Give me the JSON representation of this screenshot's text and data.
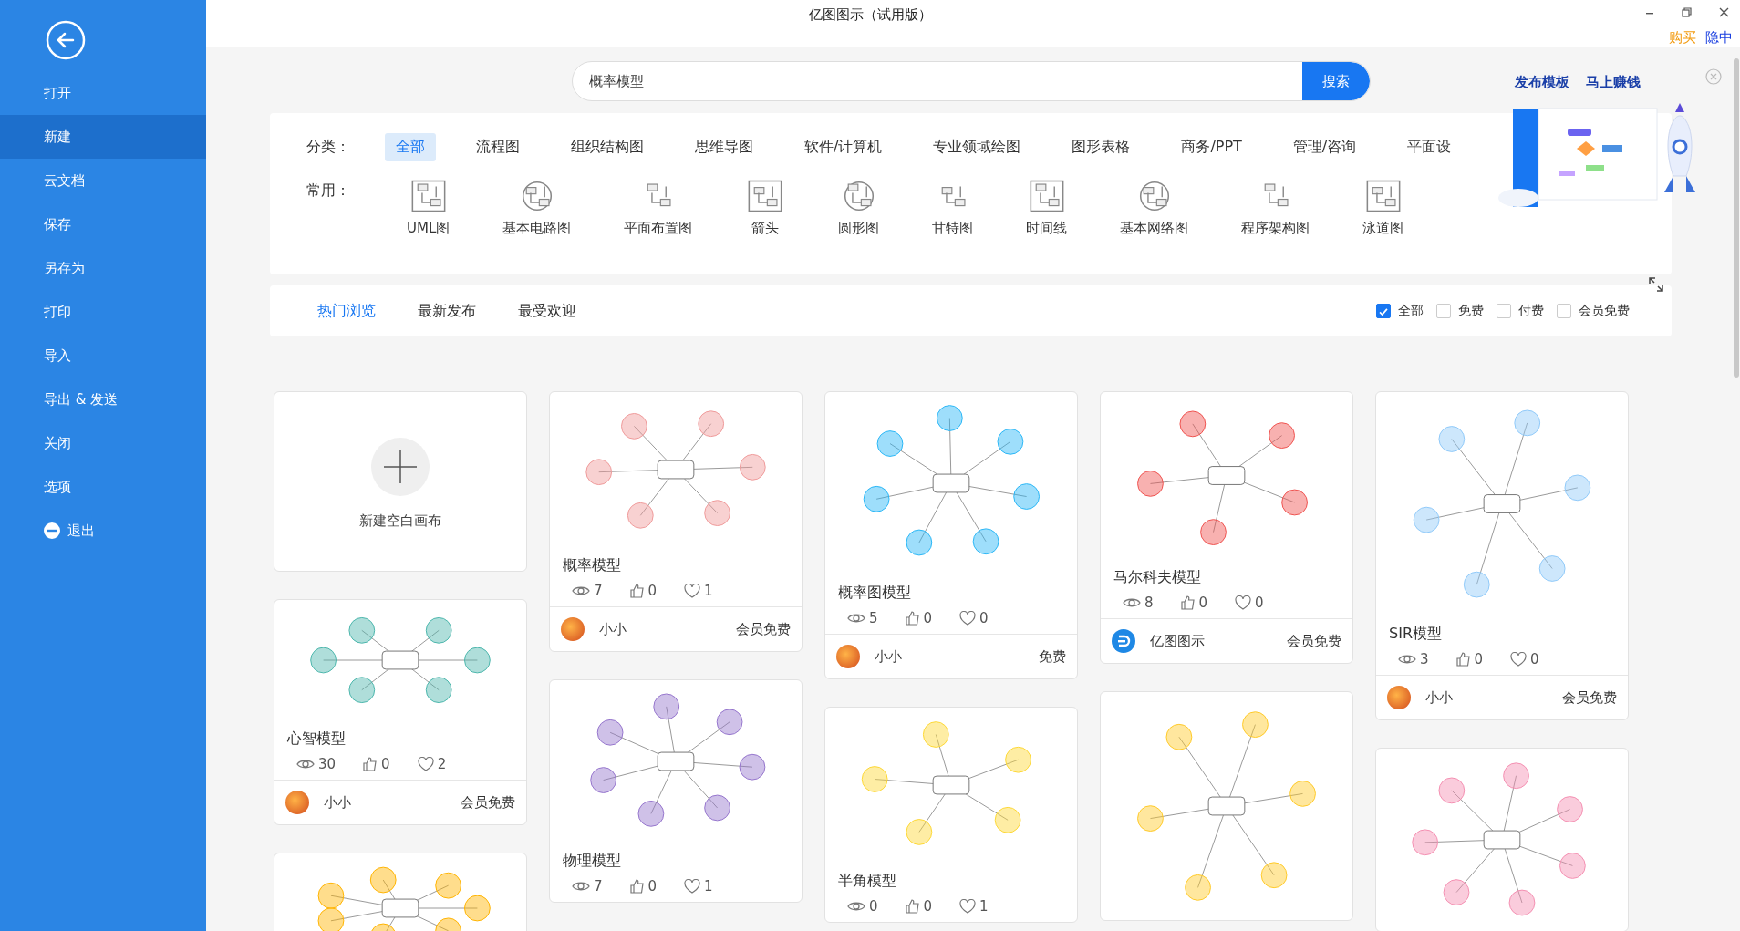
{
  "window": {
    "title": "亿图图示（试用版）"
  },
  "header_links": [
    {
      "label": "购买",
      "kind": "buy"
    },
    {
      "label": "隐中",
      "kind": "user"
    }
  ],
  "sidebar": {
    "items": [
      {
        "label": "打开",
        "selected": false,
        "kind": "item"
      },
      {
        "label": "新建",
        "selected": true,
        "kind": "item"
      },
      {
        "label": "云文档",
        "selected": false,
        "kind": "item"
      },
      {
        "label": "保存",
        "selected": false,
        "kind": "item"
      },
      {
        "label": "另存为",
        "selected": false,
        "kind": "item"
      },
      {
        "label": "打印",
        "selected": false,
        "kind": "item"
      },
      {
        "label": "导入",
        "selected": false,
        "kind": "item"
      },
      {
        "label": "导出 & 发送",
        "selected": false,
        "kind": "item"
      },
      {
        "label": "关闭",
        "selected": false,
        "kind": "item"
      },
      {
        "label": "选项",
        "selected": false,
        "kind": "item"
      },
      {
        "label": "退出",
        "selected": false,
        "kind": "exit"
      }
    ]
  },
  "search": {
    "value": "概率模型",
    "button": "搜索"
  },
  "promo": {
    "links": [
      "发布模板",
      "马上赚钱"
    ]
  },
  "categories": {
    "label": "分类：",
    "items": [
      {
        "label": "全部",
        "selected": true
      },
      {
        "label": "流程图",
        "selected": false
      },
      {
        "label": "组织结构图",
        "selected": false
      },
      {
        "label": "思维导图",
        "selected": false
      },
      {
        "label": "软件/计算机",
        "selected": false
      },
      {
        "label": "专业领域绘图",
        "selected": false
      },
      {
        "label": "图形表格",
        "selected": false
      },
      {
        "label": "商务/PPT",
        "selected": false
      },
      {
        "label": "管理/咨询",
        "selected": false
      },
      {
        "label": "平面设",
        "selected": false
      }
    ]
  },
  "common": {
    "label": "常用：",
    "items": [
      "UML图",
      "基本电路图",
      "平面布置图",
      "箭头",
      "圆形图",
      "甘特图",
      "时间线",
      "基本网络图",
      "程序架构图",
      "泳道图"
    ]
  },
  "browse_tabs": [
    {
      "label": "热门浏览",
      "selected": true
    },
    {
      "label": "最新发布",
      "selected": false
    },
    {
      "label": "最受欢迎",
      "selected": false
    }
  ],
  "filters": [
    {
      "label": "全部",
      "checked": true
    },
    {
      "label": "免费",
      "checked": false
    },
    {
      "label": "付费",
      "checked": false
    },
    {
      "label": "会员免费",
      "checked": false
    }
  ],
  "columns": [
    [
      {
        "kind": "blank",
        "label": "新建空白画布"
      },
      {
        "kind": "template",
        "title": "心智模型",
        "views": "30",
        "likes": "0",
        "favorites": "2",
        "author": "小小",
        "avatar": {
          "kind": "photo"
        },
        "price": "会员免费"
      },
      {
        "kind": "preview"
      }
    ],
    [
      {
        "kind": "template",
        "title": "概率模型",
        "views": "7",
        "likes": "0",
        "favorites": "1",
        "author": "小小",
        "avatar": {
          "kind": "photo"
        },
        "price": "会员免费"
      },
      {
        "kind": "template",
        "title": "物理模型",
        "views": "7",
        "likes": "0",
        "favorites": "1"
      }
    ],
    [
      {
        "kind": "template",
        "title": "概率图模型",
        "views": "5",
        "likes": "0",
        "favorites": "0",
        "author": "小小",
        "avatar": {
          "kind": "photo"
        },
        "price": "免费"
      },
      {
        "kind": "template",
        "title": "半角模型",
        "views": "0",
        "likes": "0",
        "favorites": "1"
      }
    ],
    [
      {
        "kind": "template",
        "title": "马尔科夫模型",
        "views": "8",
        "likes": "0",
        "favorites": "0",
        "author": "亿图图示",
        "avatar": {
          "kind": "logo"
        },
        "price": "会员免费"
      },
      {
        "kind": "preview"
      }
    ],
    [
      {
        "kind": "template",
        "title": "SIR模型",
        "views": "3",
        "likes": "0",
        "favorites": "0",
        "author": "小小",
        "avatar": {
          "kind": "photo"
        },
        "price": "会员免费"
      },
      {
        "kind": "preview"
      }
    ]
  ]
}
